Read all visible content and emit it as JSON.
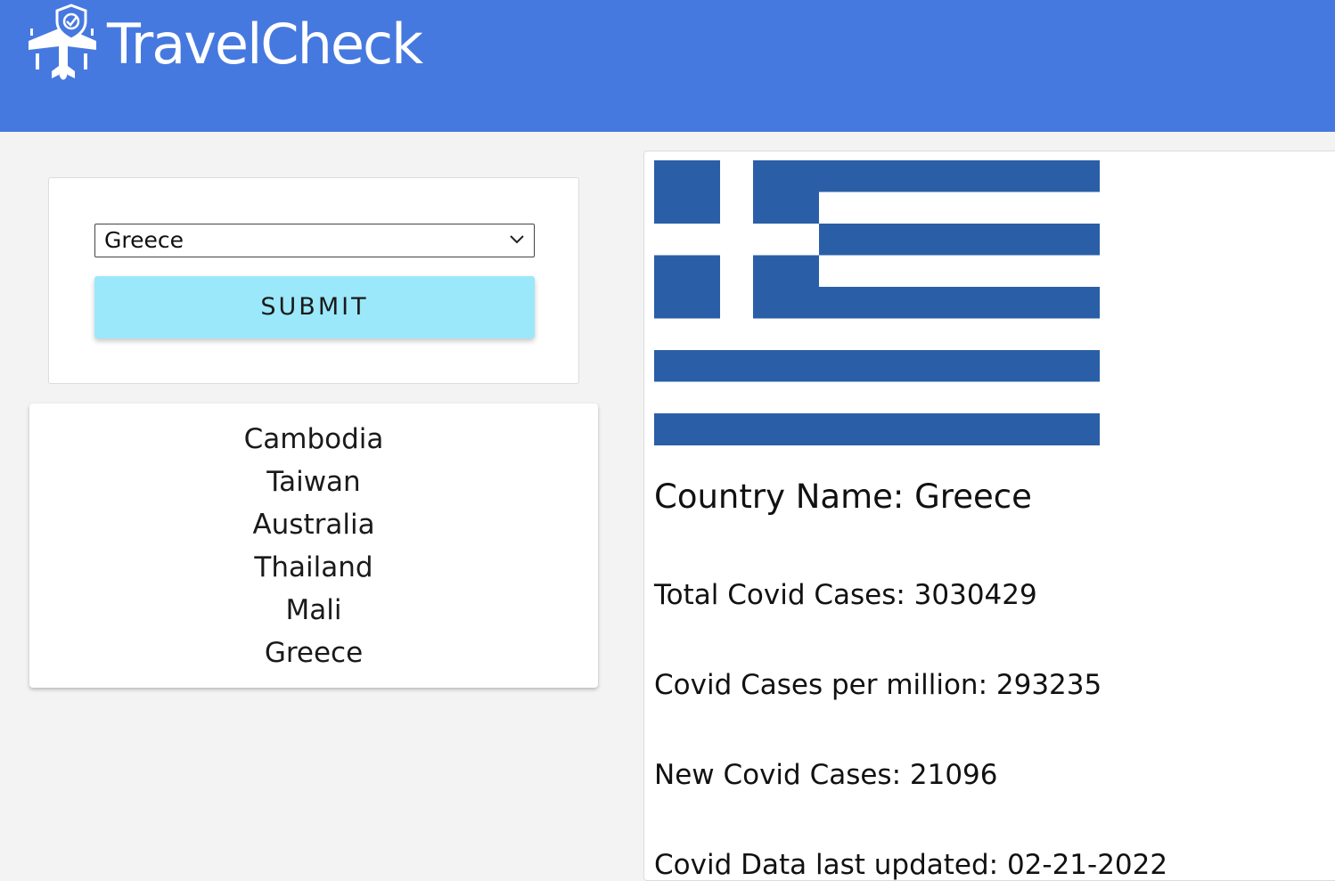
{
  "header": {
    "brand": "TravelCheck",
    "logo_icon": "plane-shield-check-icon",
    "background": "#4679df"
  },
  "form": {
    "selected_country": "Greece",
    "submit_label": "SUBMIT",
    "submit_color": "#9be8fa"
  },
  "recent_countries": [
    "Cambodia",
    "Taiwan",
    "Australia",
    "Thailand",
    "Mali",
    "Greece"
  ],
  "details": {
    "flag_icon": "greece-flag",
    "country_name": "Country Name: Greece",
    "total_cases": "Total Covid Cases: 3030429",
    "cases_per_million": "Covid Cases per million: 293235",
    "new_cases": "New Covid Cases: 21096",
    "last_updated": "Covid Data last updated: 02-21-2022"
  }
}
